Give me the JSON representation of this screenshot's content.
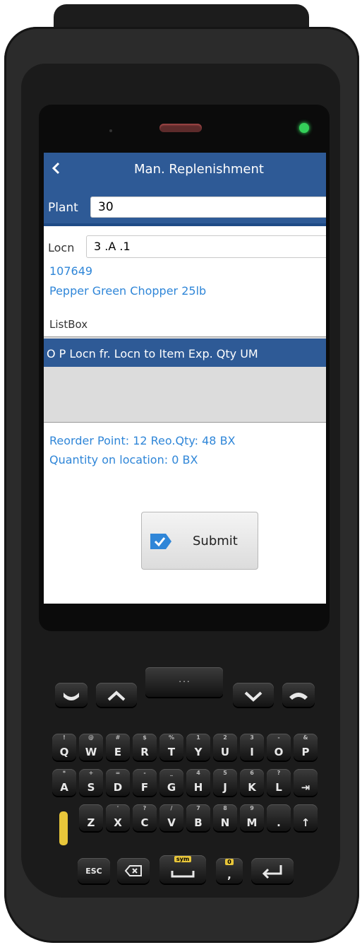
{
  "app": {
    "title": "Man. Replenishment"
  },
  "form": {
    "plant_label": "Plant",
    "plant_value": "30",
    "locn_label": "Locn",
    "locn_value": "3 .A  .1",
    "item_number": "107649",
    "item_description": "Pepper Green Chopper 25lb",
    "listbox_label": "ListBox",
    "list_header": "O P Locn fr. Locn to  Item Exp. Qty UM",
    "reorder_info": "Reorder Point: 12 Reo.Qty: 48 BX",
    "quantity_info": "Quantity on location: 0 BX",
    "submit_label": "Submit"
  },
  "keypad": {
    "row1": [
      "Q",
      "W",
      "E",
      "R",
      "T",
      "Y",
      "U",
      "I",
      "O",
      "P"
    ],
    "row1_sub": [
      "!",
      "@",
      "#",
      "$",
      "%",
      "1",
      "2",
      "3",
      "-",
      "&"
    ],
    "row2": [
      "A",
      "S",
      "D",
      "F",
      "G",
      "H",
      "J",
      "K",
      "L",
      "⇥"
    ],
    "row2_sub": [
      "*",
      "+",
      "=",
      "-",
      "_",
      "4",
      "5",
      "6",
      "?",
      ""
    ],
    "row3": [
      "Z",
      "X",
      "C",
      "V",
      "B",
      "N",
      "M",
      ".",
      "↑"
    ],
    "row3_sub": [
      "",
      "'",
      "?",
      "/",
      "7",
      "8",
      "9",
      "",
      ""
    ],
    "esc_label": "ESC",
    "sym_label": "sym",
    "zero_label": "0",
    "comma_label": ","
  },
  "colors": {
    "header_blue": "#2e5a96",
    "link_blue": "#2f86d8",
    "accent_yellow": "#e8c63a",
    "led_green": "#34d05a"
  }
}
